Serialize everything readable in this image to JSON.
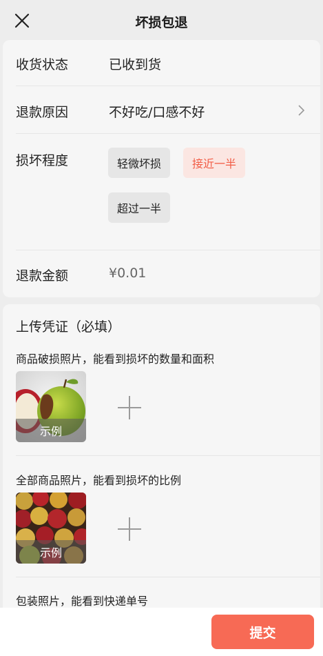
{
  "header": {
    "title": "坏损包退",
    "close_icon": "close-icon"
  },
  "form": {
    "status_label": "收货状态",
    "status_value": "已收到货",
    "reason_label": "退款原因",
    "reason_value": "不好吃/口感不好",
    "damage_label": "损坏程度",
    "damage_options": [
      {
        "label": "轻微坏损",
        "selected": false
      },
      {
        "label": "接近一半",
        "selected": true
      },
      {
        "label": "超过一半",
        "selected": false
      }
    ],
    "amount_label": "退款金额",
    "amount_value": "¥0.01"
  },
  "upload": {
    "title": "上传凭证（必填）",
    "sections": [
      {
        "hint": "商品破损照片，能看到损坏的数量和面积",
        "example_label": "示例"
      },
      {
        "hint": "全部商品照片，能看到损坏的比例",
        "example_label": "示例"
      },
      {
        "hint": "包装照片，能看到快递单号"
      }
    ]
  },
  "footer": {
    "submit_label": "提交"
  },
  "colors": {
    "accent": "#f76a55",
    "selected_text": "#f25c45",
    "selected_bg": "#fbe6e2",
    "page_bg": "#ededed",
    "card_bg": "#f6f6f6"
  }
}
